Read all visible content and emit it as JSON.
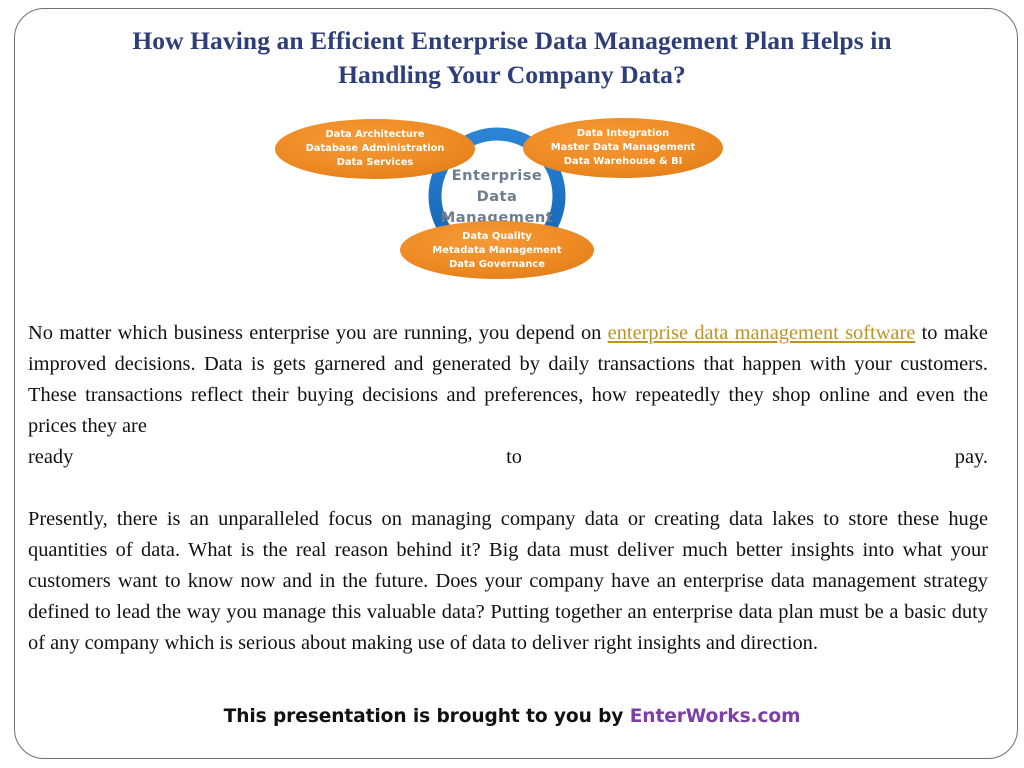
{
  "slide": {
    "title_line_1": "How Having an Efficient Enterprise Data Management Plan Helps in",
    "title_line_2": "Handling Your Company Data?",
    "title_color": "#2d3e78",
    "border_color": "#6f6f76",
    "background": "#ffffff"
  },
  "diagram": {
    "name": "enterprise-data-management-venn",
    "ring_color": "#1d72c4",
    "bubble_color": "#ee8a23",
    "bubble_text_color": "#ffffff",
    "center_text_color": "#6d7d8e",
    "center": {
      "line1": "Enterprise",
      "line2": "Data",
      "line3": "Management"
    },
    "bubbles": [
      {
        "position": "top-left",
        "line1": "Data Architecture",
        "line2": "Database Administration",
        "line3": "Data Services"
      },
      {
        "position": "top-right",
        "line1": "Data Integration",
        "line2": "Master Data Management",
        "line3": "Data Warehouse & BI"
      },
      {
        "position": "bottom",
        "line1": "Data Quality",
        "line2": "Metadata Management",
        "line3": "Data Governance"
      }
    ]
  },
  "body": {
    "paragraph_1": {
      "text_before_link": "No matter which business enterprise you are running, you depend on ",
      "link_text": "enterprise data management software",
      "link_color": "#bf9322",
      "text_after_link": " to make improved decisions. Data is gets garnered and generated by daily transactions that happen with your customers. These transactions reflect their buying decisions and preferences, how repeatedly they shop online and even the prices they are",
      "last_line_word_1": "ready",
      "last_line_word_2": "to",
      "last_line_word_3": "pay."
    },
    "paragraph_2": "Presently, there is an unparalleled focus on managing company data or creating data lakes to store these huge quantities of  data. What is the real reason behind it? Big data must deliver much better insights into what your customers want to know now and in the future. Does your company have an enterprise data management strategy defined to lead the way you manage this valuable data? Putting together an enterprise data plan must be a basic duty of  any company which is serious about making use of  data to deliver right insights and direction."
  },
  "footer": {
    "text": "This presentation is brought to you by ",
    "brand": "EnterWorks.com",
    "brand_color": "#7e3fa5"
  }
}
